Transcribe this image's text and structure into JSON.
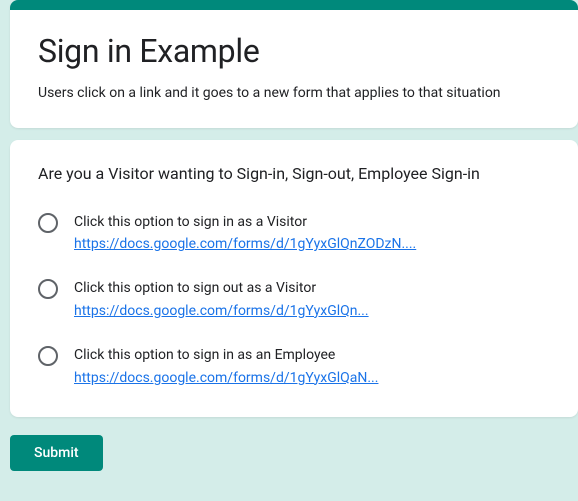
{
  "header": {
    "title": "Sign in Example",
    "description": "Users click on a link and it goes to a new form that applies to that situation"
  },
  "question": {
    "title": "Are you a Visitor wanting to Sign-in, Sign-out, Employee Sign-in",
    "options": [
      {
        "label": "Click this option to sign in as a Visitor",
        "link": "https://docs.google.com/forms/d/1gYyxGlQnZODzN...."
      },
      {
        "label": "Click this option to sign out as a Visitor",
        "link": "https://docs.google.com/forms/d/1gYyxGlQn..."
      },
      {
        "label": "Click this option to sign in as an Employee",
        "link": "https://docs.google.com/forms/d/1gYyxGlQaN..."
      }
    ]
  },
  "submit_label": "Submit"
}
